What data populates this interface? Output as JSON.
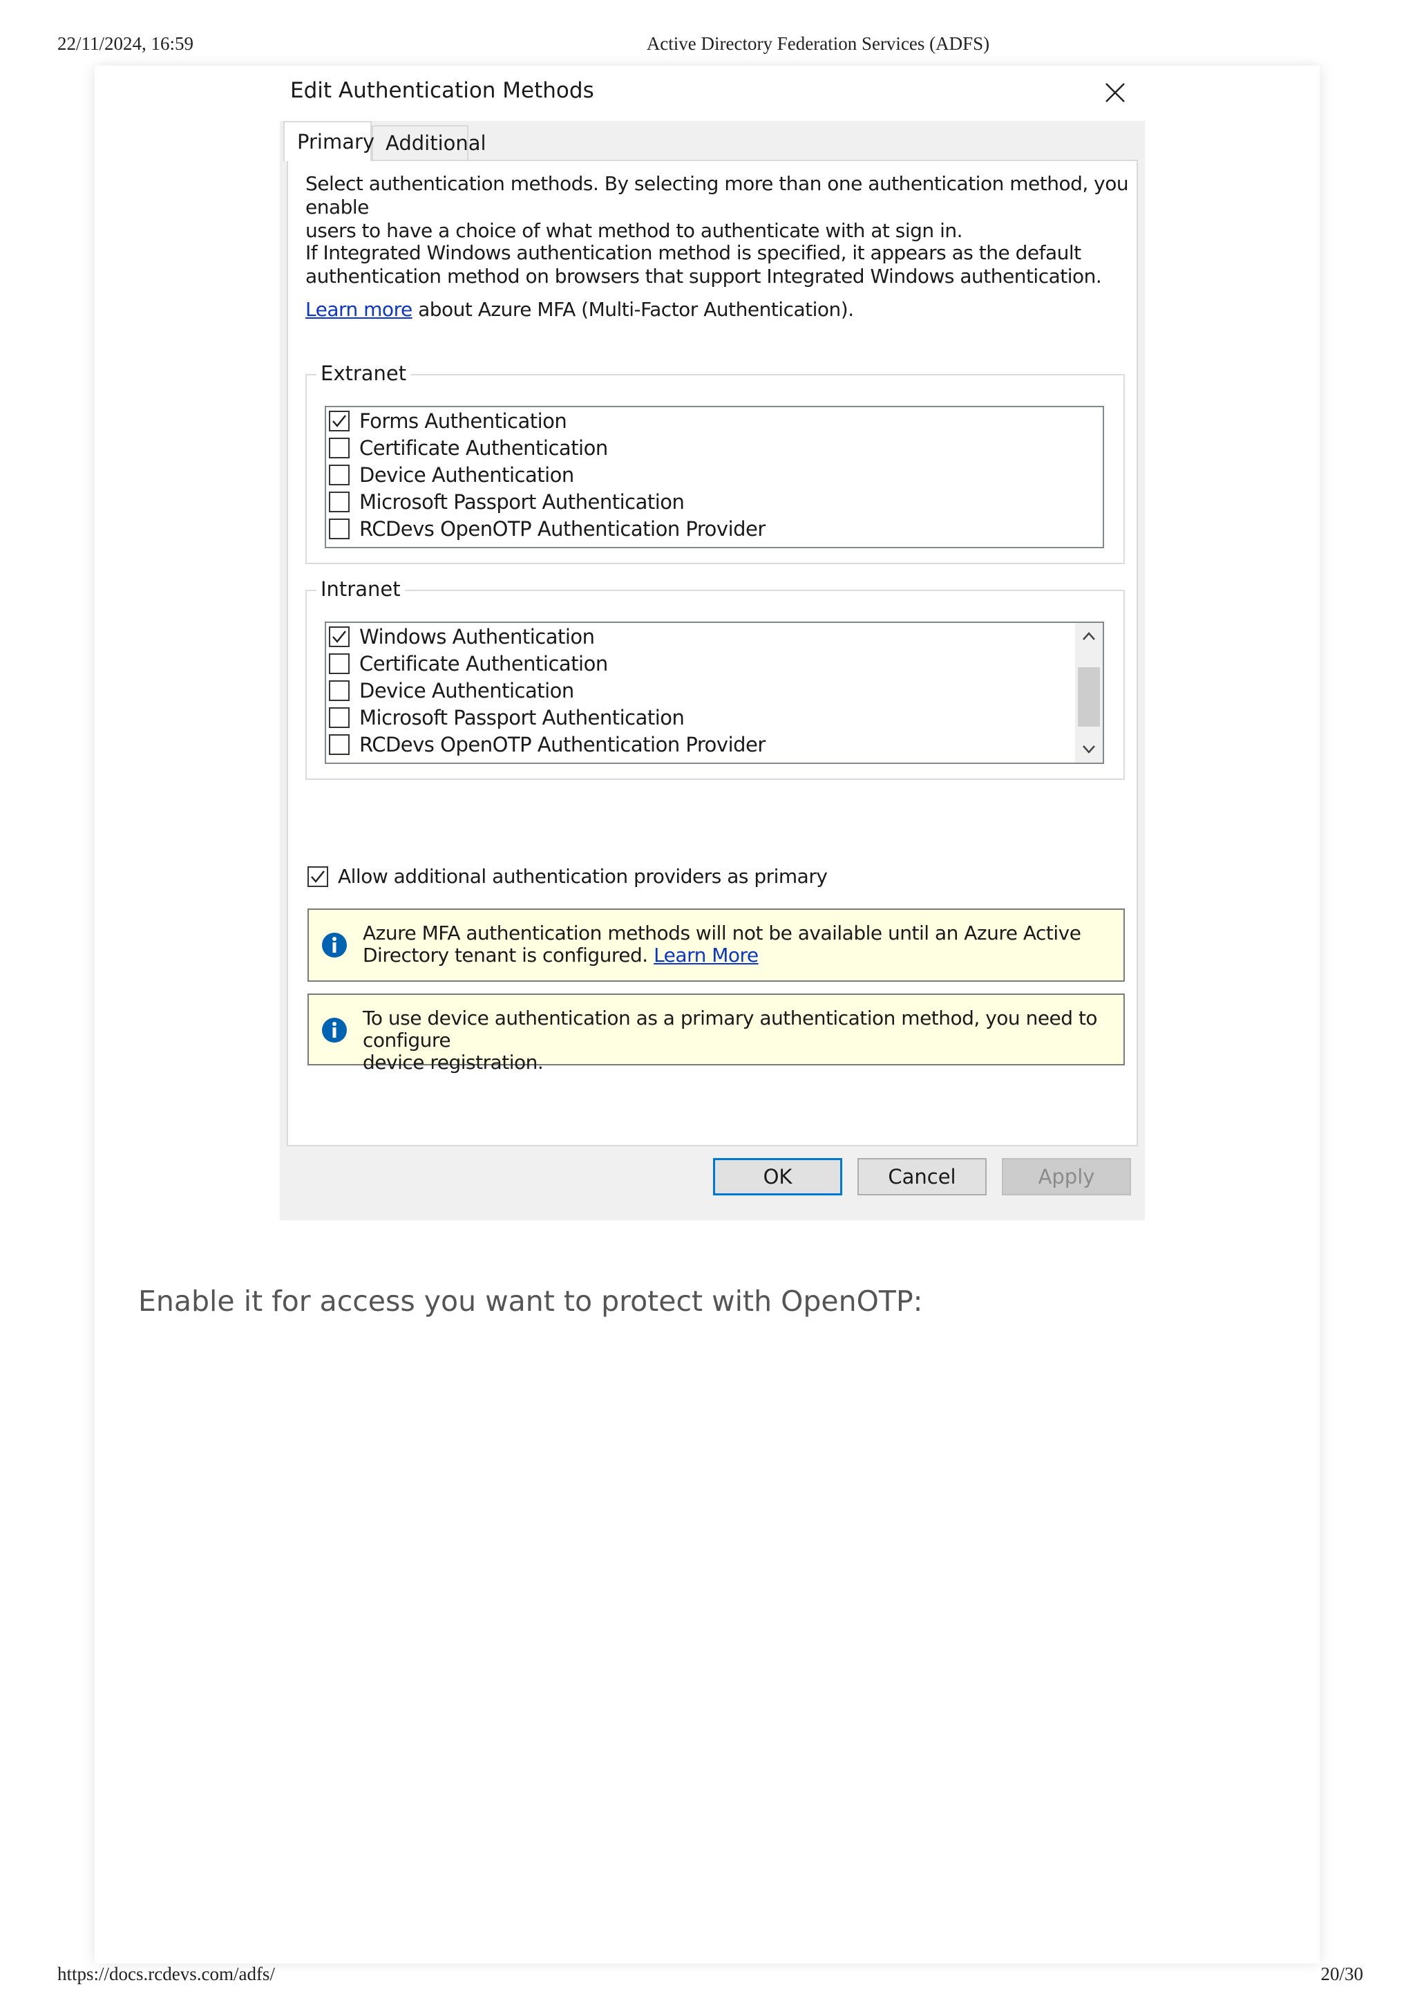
{
  "print_header": {
    "datetime": "22/11/2024, 16:59",
    "title": "Active Directory Federation Services (ADFS)"
  },
  "print_footer": {
    "url": "https://docs.rcdevs.com/adfs/",
    "page": "20/30"
  },
  "dialog": {
    "title": "Edit Authentication Methods",
    "tabs": [
      {
        "label": "Primary",
        "active": true
      },
      {
        "label": "Additional",
        "active": false
      }
    ],
    "intro_line1": "Select authentication methods. By selecting more than one authentication method, you enable",
    "intro_line2": "users to have a choice of what method to authenticate with at sign in.",
    "iwa_line1": "If Integrated Windows authentication method is specified, it appears as the default",
    "iwa_line2": "authentication method on browsers that support Integrated Windows authentication.",
    "learn_more_link": "Learn more",
    "learn_more_suffix": " about Azure MFA (Multi-Factor Authentication).",
    "extranet": {
      "label": "Extranet",
      "items": [
        {
          "label": "Forms Authentication",
          "checked": true
        },
        {
          "label": "Certificate Authentication",
          "checked": false
        },
        {
          "label": "Device Authentication",
          "checked": false
        },
        {
          "label": "Microsoft Passport Authentication",
          "checked": false
        },
        {
          "label": "RCDevs OpenOTP Authentication Provider",
          "checked": false
        }
      ]
    },
    "intranet": {
      "label": "Intranet",
      "items": [
        {
          "label": "Windows Authentication",
          "checked": true
        },
        {
          "label": "Certificate Authentication",
          "checked": false
        },
        {
          "label": "Device Authentication",
          "checked": false
        },
        {
          "label": "Microsoft Passport Authentication",
          "checked": false
        },
        {
          "label": "RCDevs OpenOTP Authentication Provider",
          "checked": false
        }
      ]
    },
    "allow_additional": {
      "label": "Allow additional authentication providers as primary",
      "checked": true
    },
    "info1": {
      "line1": "Azure MFA authentication methods will not be available until an Azure Active",
      "line2": "Directory tenant is configured. ",
      "link": "Learn More"
    },
    "info2": {
      "line1": "To use device authentication as a primary authentication method, you need to configure",
      "line2": "device registration."
    },
    "buttons": {
      "ok": "OK",
      "cancel": "Cancel",
      "apply": "Apply"
    }
  },
  "body_text": "Enable it for access you want to protect with OpenOTP:",
  "colors": {
    "link": "#0b36c9",
    "info_bg": "#ffffe1",
    "info_icon": "#0063b1",
    "ok_border": "#0078d7"
  }
}
